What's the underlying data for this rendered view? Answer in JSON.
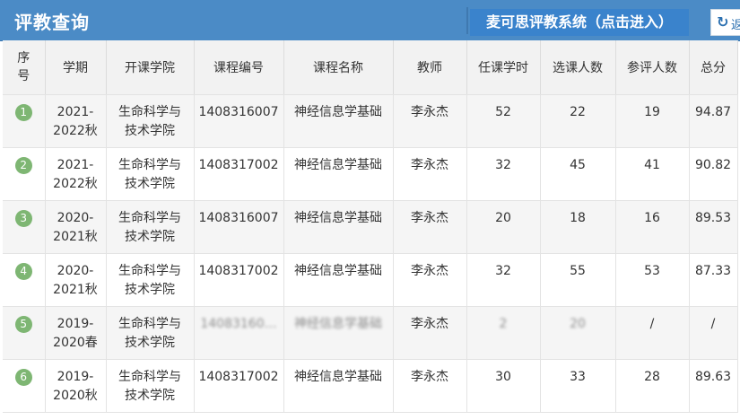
{
  "header": {
    "title": "评教查询",
    "mcs_button": "麦可思评教系统（点击进入）",
    "refresh_label": "返回"
  },
  "table": {
    "columns": [
      "序号",
      "学期",
      "开课学院",
      "课程编号",
      "课程名称",
      "教师",
      "任课学时",
      "选课人数",
      "参评人数",
      "总分"
    ],
    "rows": [
      {
        "idx": "1",
        "term": "2021-2022秋",
        "college": "生命科学与技术学院",
        "course_no": "1408316007",
        "course_name": "神经信息学基础",
        "teacher": "李永杰",
        "hours": "52",
        "enrolled": "22",
        "rated": "19",
        "score": "94.87"
      },
      {
        "idx": "2",
        "term": "2021-2022秋",
        "college": "生命科学与技术学院",
        "course_no": "1408317002",
        "course_name": "神经信息学基础",
        "teacher": "李永杰",
        "hours": "32",
        "enrolled": "45",
        "rated": "41",
        "score": "90.82"
      },
      {
        "idx": "3",
        "term": "2020-2021秋",
        "college": "生命科学与技术学院",
        "course_no": "1408316007",
        "course_name": "神经信息学基础",
        "teacher": "李永杰",
        "hours": "20",
        "enrolled": "18",
        "rated": "16",
        "score": "89.53"
      },
      {
        "idx": "4",
        "term": "2020-2021秋",
        "college": "生命科学与技术学院",
        "course_no": "1408317002",
        "course_name": "神经信息学基础",
        "teacher": "李永杰",
        "hours": "32",
        "enrolled": "55",
        "rated": "53",
        "score": "87.33"
      },
      {
        "idx": "5",
        "term": "2019-2020春",
        "college": "生命科学与技术学院",
        "course_no": "14083160…",
        "course_name": "神经信息学基础",
        "teacher": "李永杰",
        "hours": "2",
        "enrolled": "20",
        "rated": "/",
        "score": "/"
      },
      {
        "idx": "6",
        "term": "2019-2020秋",
        "college": "生命科学与技术学院",
        "course_no": "1408317002",
        "course_name": "神经信息学基础",
        "teacher": "李永杰",
        "hours": "30",
        "enrolled": "33",
        "rated": "28",
        "score": "89.63"
      }
    ]
  },
  "colors": {
    "header_bg": "#4b8bc6",
    "button_bg": "#3a83cc",
    "badge": "#7eb673"
  },
  "icons": {
    "refresh": "refresh-icon"
  }
}
